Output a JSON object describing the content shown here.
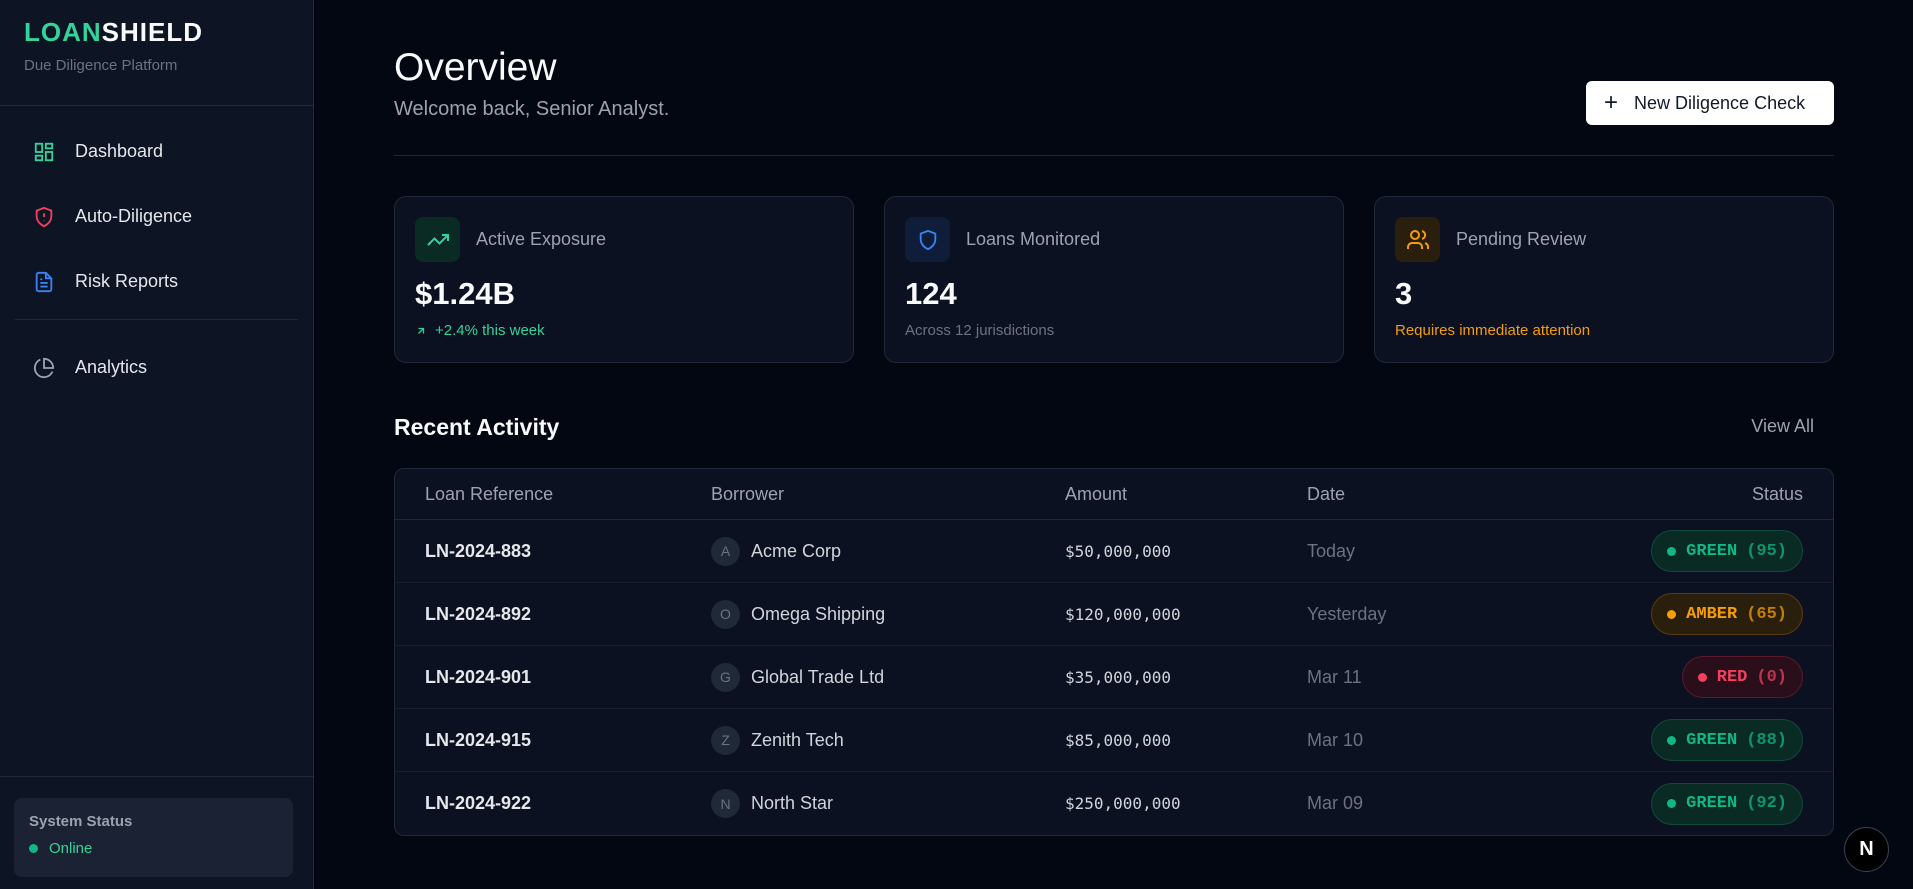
{
  "brand": {
    "part1": "LOAN",
    "part2": "SHIELD",
    "subtitle": "Due Diligence Platform"
  },
  "sidebar": {
    "items": [
      {
        "label": "Dashboard",
        "icon": "dashboard-grid-icon",
        "color": "#34d399"
      },
      {
        "label": "Auto-Diligence",
        "icon": "shield-alert-icon",
        "color": "#f43f5e"
      },
      {
        "label": "Risk Reports",
        "icon": "document-icon",
        "color": "#3b82f6"
      },
      {
        "label": "Analytics",
        "icon": "pie-chart-icon",
        "color": "#9ca3af"
      }
    ],
    "status": {
      "title": "System Status",
      "value": "Online"
    }
  },
  "header": {
    "title": "Overview",
    "subtitle": "Welcome back, Senior Analyst.",
    "new_button": "New Diligence Check"
  },
  "cards": [
    {
      "label": "Active Exposure",
      "value": "$1.24B",
      "note": "+2.4% this week",
      "icon": "trending-up-icon",
      "accent": "#34d399"
    },
    {
      "label": "Loans Monitored",
      "value": "124",
      "note": "Across 12 jurisdictions",
      "icon": "shield-icon",
      "accent": "#3b82f6"
    },
    {
      "label": "Pending Review",
      "value": "3",
      "note": "Requires immediate attention",
      "icon": "users-icon",
      "accent": "#f59e0b"
    }
  ],
  "activity": {
    "title": "Recent Activity",
    "view_all": "View All",
    "columns": [
      "Loan Reference",
      "Borrower",
      "Amount",
      "Date",
      "Status"
    ],
    "rows": [
      {
        "ref": "LN-2024-883",
        "initial": "A",
        "borrower": "Acme Corp",
        "amount": "$50,000,000",
        "date": "Today",
        "status": "GREEN",
        "score": "(95)"
      },
      {
        "ref": "LN-2024-892",
        "initial": "O",
        "borrower": "Omega Shipping",
        "amount": "$120,000,000",
        "date": "Yesterday",
        "status": "AMBER",
        "score": "(65)"
      },
      {
        "ref": "LN-2024-901",
        "initial": "G",
        "borrower": "Global Trade Ltd",
        "amount": "$35,000,000",
        "date": "Mar 11",
        "status": "RED",
        "score": "(0)"
      },
      {
        "ref": "LN-2024-915",
        "initial": "Z",
        "borrower": "Zenith Tech",
        "amount": "$85,000,000",
        "date": "Mar 10",
        "status": "GREEN",
        "score": "(88)"
      },
      {
        "ref": "LN-2024-922",
        "initial": "N",
        "borrower": "North Star",
        "amount": "$250,000,000",
        "date": "Mar 09",
        "status": "GREEN",
        "score": "(92)"
      }
    ]
  },
  "next_badge": "N"
}
